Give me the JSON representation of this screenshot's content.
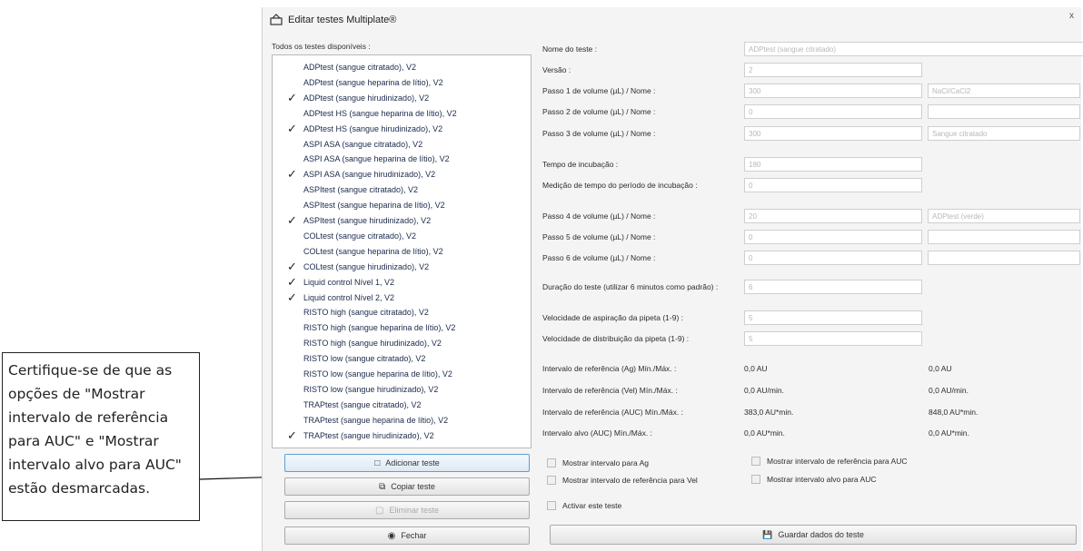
{
  "window": {
    "title": "Editar testes Multiplate®",
    "close_glyph": "x"
  },
  "left": {
    "label": "Todos os testes disponíveis :",
    "tests": [
      {
        "label": "ADPtest (sangue citratado), V2",
        "checked": false
      },
      {
        "label": "ADPtest (sangue heparina de lítio), V2",
        "checked": false
      },
      {
        "label": "ADPtest (sangue hirudinizado), V2",
        "checked": true
      },
      {
        "label": "ADPtest HS (sangue heparina de lítio), V2",
        "checked": false
      },
      {
        "label": "ADPtest HS (sangue hirudinizado), V2",
        "checked": true
      },
      {
        "label": "ASPI ASA (sangue citratado), V2",
        "checked": false
      },
      {
        "label": "ASPI ASA (sangue heparina de lítio), V2",
        "checked": false
      },
      {
        "label": "ASPI ASA (sangue hirudinizado), V2",
        "checked": true
      },
      {
        "label": "ASPItest (sangue citratado), V2",
        "checked": false
      },
      {
        "label": "ASPItest (sangue heparina de lítio), V2",
        "checked": false
      },
      {
        "label": "ASPItest (sangue hirudinizado), V2",
        "checked": true
      },
      {
        "label": "COLtest (sangue citratado), V2",
        "checked": false
      },
      {
        "label": "COLtest (sangue heparina de lítio), V2",
        "checked": false
      },
      {
        "label": "COLtest (sangue hirudinizado), V2",
        "checked": true
      },
      {
        "label": "Liquid control Nível 1, V2",
        "checked": true
      },
      {
        "label": "Liquid control Nível 2, V2",
        "checked": true
      },
      {
        "label": "RISTO high (sangue citratado), V2",
        "checked": false
      },
      {
        "label": "RISTO high (sangue heparina de lítio), V2",
        "checked": false
      },
      {
        "label": "RISTO high (sangue hirudinizado), V2",
        "checked": false
      },
      {
        "label": "RISTO low (sangue citratado), V2",
        "checked": false
      },
      {
        "label": "RISTO low (sangue heparina de lítio), V2",
        "checked": false
      },
      {
        "label": "RISTO low (sangue hirudinizado), V2",
        "checked": false
      },
      {
        "label": "TRAPtest (sangue citratado), V2",
        "checked": false
      },
      {
        "label": "TRAPtest (sangue heparina de lítio), V2",
        "checked": false
      },
      {
        "label": "TRAPtest (sangue hirudinizado), V2",
        "checked": true
      }
    ],
    "buttons": {
      "add": "Adicionar teste",
      "copy": "Copiar teste",
      "delete": "Eliminar teste",
      "close": "Fechar"
    }
  },
  "form": {
    "test_name": {
      "label": "Nome do teste :",
      "value": "ADPtest (sangue citratado)"
    },
    "version": {
      "label": "Versão :",
      "value": "2"
    },
    "step1": {
      "label": "Passo 1 de volume (µL) / Nome :",
      "volume": "300",
      "name": "NaCl/CaCl2"
    },
    "step2": {
      "label": "Passo 2 de volume (µL) / Nome :",
      "volume": "0",
      "name": ""
    },
    "step3": {
      "label": "Passo 3 de volume (µL) / Nome :",
      "volume": "300",
      "name": "Sangue citratado"
    },
    "incubation_time": {
      "label": "Tempo de incubação :",
      "value": "180"
    },
    "incubation_measure": {
      "label": "Medição de tempo do período de incubação :",
      "value": "0"
    },
    "step4": {
      "label": "Passo 4 de volume (µL) / Nome :",
      "volume": "20",
      "name": "ADPtest (verde)"
    },
    "step5": {
      "label": "Passo 5 de volume (µL) / Nome :",
      "volume": "0",
      "name": ""
    },
    "step6": {
      "label": "Passo 6 de volume (µL) / Nome :",
      "volume": "0",
      "name": ""
    },
    "duration": {
      "label": "Duração do teste (utilizar 6 minutos como padrão) :",
      "value": "6"
    },
    "aspiration_speed": {
      "label": "Velocidade de aspiração da pipeta (1-9) :",
      "value": "5"
    },
    "dispense_speed": {
      "label": "Velocidade de distribuição da pipeta (1-9) :",
      "value": "5"
    },
    "ref_ag": {
      "label": "Intervalo de referência (Ag) Mín./Máx. :",
      "min": "0,0 AU",
      "max": "0,0 AU"
    },
    "ref_vel": {
      "label": "Intervalo de referência (Vel) Mín./Máx. :",
      "min": "0,0 AU/min.",
      "max": "0,0 AU/min."
    },
    "ref_auc": {
      "label": "Intervalo de referência (AUC) Mín./Máx. :",
      "min": "383,0 AU*min.",
      "max": "848,0 AU*min."
    },
    "target_auc": {
      "label": "Intervalo alvo (AUC) Mín./Máx. :",
      "min": "0,0 AU*min.",
      "max": "0,0 AU*min."
    },
    "checkboxes": {
      "show_ag": "Mostrar intervalo para Ag",
      "show_ref_auc": "Mostrar intervalo de referência para AUC",
      "show_ref_vel": "Mostrar intervalo de referência para Vel",
      "show_target_auc": "Mostrar intervalo alvo para AUC",
      "activate": "Activar este teste"
    },
    "save_button": "Guardar dados do teste"
  },
  "annotation": {
    "text": "Certifique-se de que as opções de \"Mostrar intervalo de referência para AUC\" e \"Mostrar intervalo alvo para AUC\" estão desmarcadas."
  }
}
